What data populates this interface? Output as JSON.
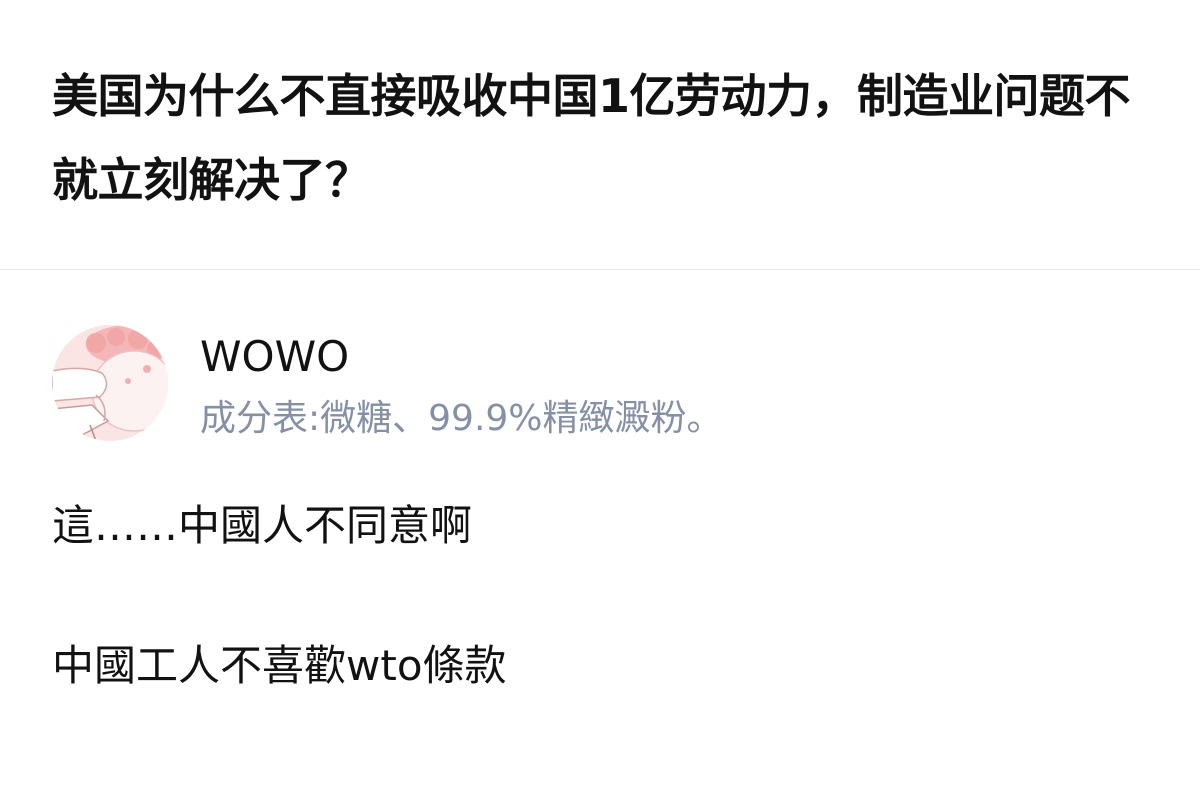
{
  "question": {
    "title": "美国为什么不直接吸收中国1亿劳动力，制造业问题不就立刻解决了？"
  },
  "author": {
    "name": "WOWO",
    "headline": "成分表:微糖、99.9%精緻澱粉。",
    "avatar_icon": "cartoon-avatar-icon",
    "colors": {
      "headline": "#8590a6",
      "avatar_bg": "#fbe4e4"
    }
  },
  "answer": {
    "paragraphs": [
      "這……中國人不同意啊",
      "中國工人不喜歡wto條款"
    ]
  }
}
